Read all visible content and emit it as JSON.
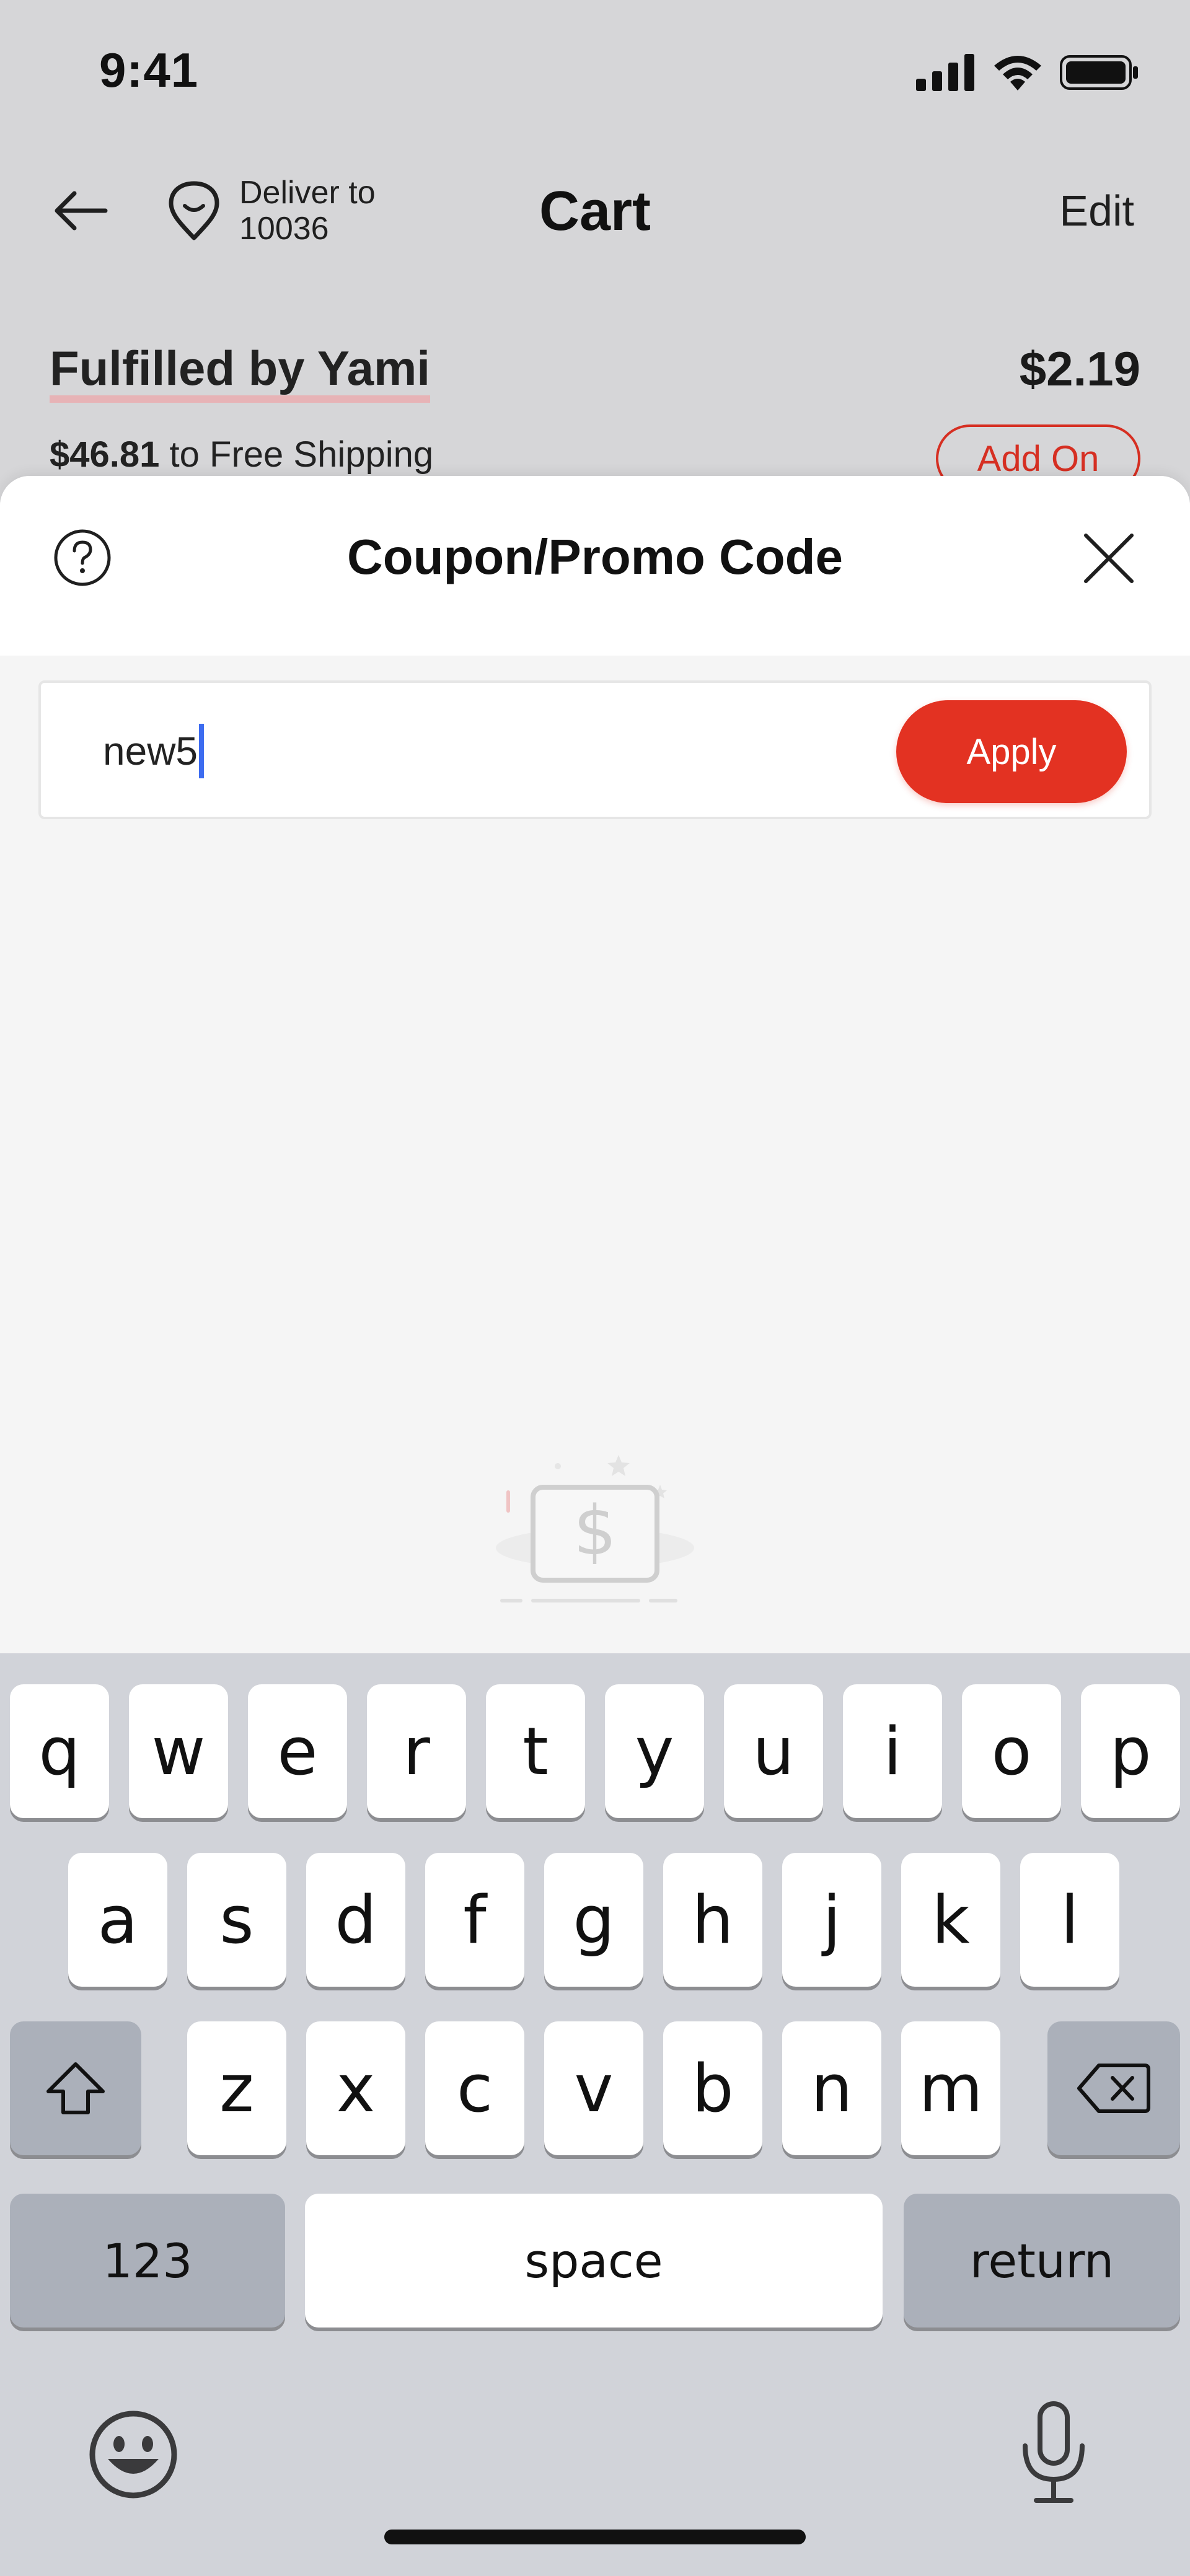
{
  "status_bar": {
    "time": "9:41"
  },
  "header": {
    "deliver_label": "Deliver to",
    "deliver_zip": "10036",
    "title": "Cart",
    "edit_label": "Edit"
  },
  "fulfillment": {
    "title": "Fulfilled by Yami",
    "price": "$2.19",
    "remaining_amount": "$46.81",
    "remaining_text": "to Free Shipping",
    "add_on_label": "Add On"
  },
  "sheet": {
    "title": "Coupon/Promo Code",
    "promo_value": "new5",
    "apply_label": "Apply"
  },
  "keyboard": {
    "row1": [
      "q",
      "w",
      "e",
      "r",
      "t",
      "y",
      "u",
      "i",
      "o",
      "p"
    ],
    "row2": [
      "a",
      "s",
      "d",
      "f",
      "g",
      "h",
      "j",
      "k",
      "l"
    ],
    "row3": [
      "z",
      "x",
      "c",
      "v",
      "b",
      "n",
      "m"
    ],
    "numbers_label": "123",
    "space_label": "space",
    "return_label": "return"
  },
  "colors": {
    "accent_red": "#e33222",
    "caret_blue": "#3d6cf0"
  }
}
